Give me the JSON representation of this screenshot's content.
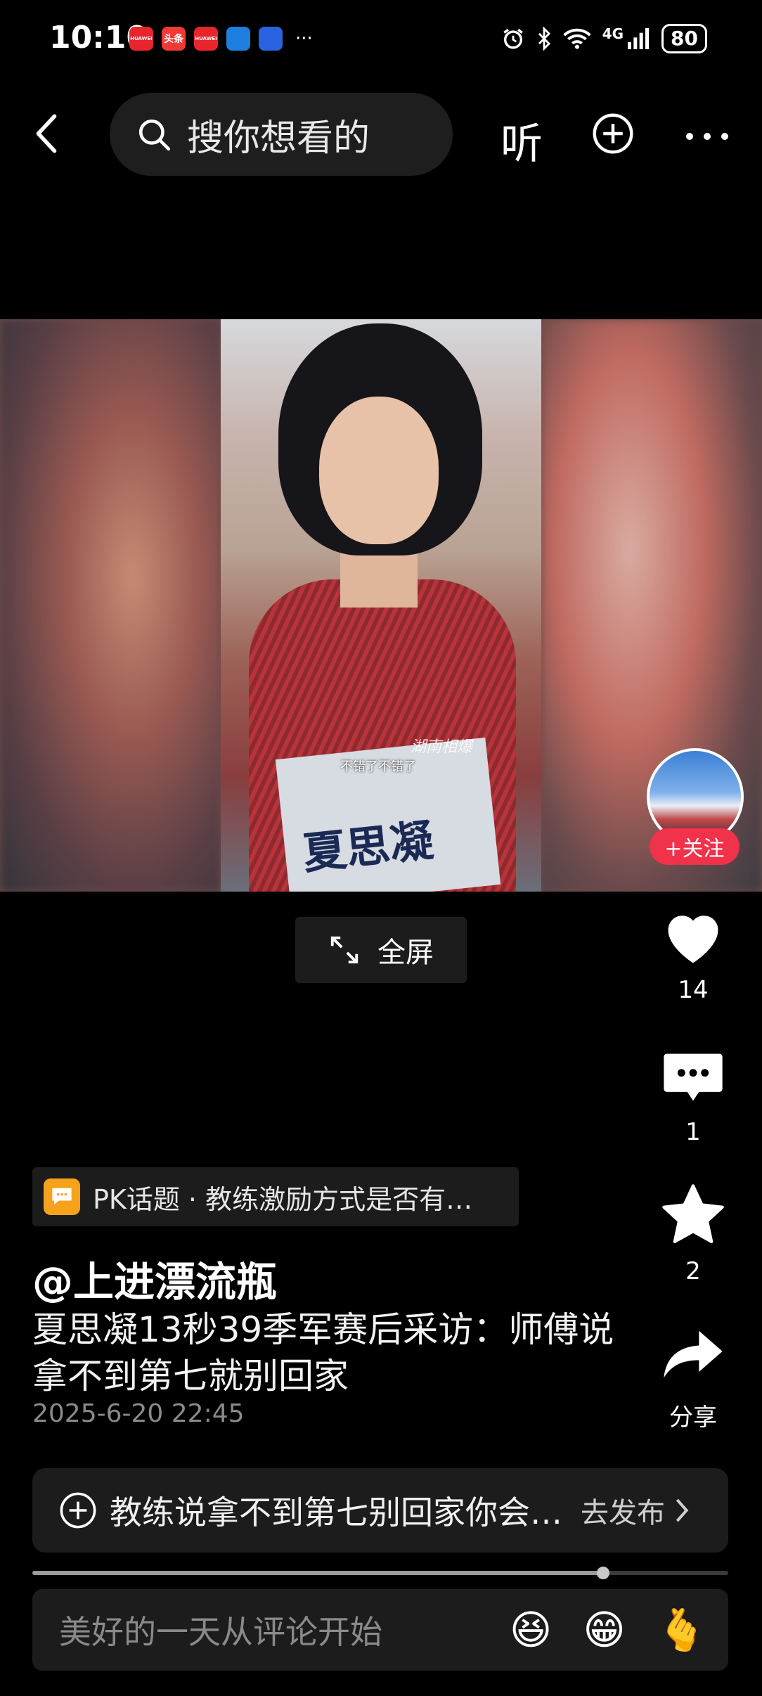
{
  "status": {
    "time": "10:10",
    "apps": [
      {
        "name": "huawei",
        "color": "#e8242c",
        "text": "HUAWEI"
      },
      {
        "name": "toutiao",
        "color": "#f23a34",
        "text": "头条"
      },
      {
        "name": "huawei",
        "color": "#e8242c",
        "text": "HUAWEI"
      },
      {
        "name": "app-blue",
        "color": "#1f7fe0",
        "text": ""
      },
      {
        "name": "baidu",
        "color": "#2a63e0",
        "text": ""
      }
    ],
    "overflow": "···",
    "network": "4G",
    "battery": "80"
  },
  "nav": {
    "search_placeholder": "搜你想看的",
    "listen_label": "听"
  },
  "video": {
    "subtitle": "不错了不错了",
    "watermark": "湖南相爆",
    "bib_name": "夏思凝",
    "fullscreen_label": "全屏"
  },
  "rail": {
    "follow_label": "+关注",
    "likes": "14",
    "comments": "1",
    "favorites": "2",
    "share_label": "分享"
  },
  "info": {
    "topic": "PK话题 · 教练激励方式是否有…",
    "author": "@上进漂流瓶",
    "description": "夏思凝13秒39季军赛后采访：师傅说拿不到第七就别回家",
    "time": "2025-6-20 22:45"
  },
  "publish": {
    "prompt": "教练说拿不到第七别回家你会…",
    "action": "去发布"
  },
  "playback": {
    "progress": 0.82
  },
  "comment": {
    "placeholder": "美好的一天从评论开始",
    "emojis": [
      "😆",
      "😁",
      "🫰"
    ]
  },
  "colors": {
    "follow": "#f0324b",
    "topic_icon": "#f7a21b"
  }
}
